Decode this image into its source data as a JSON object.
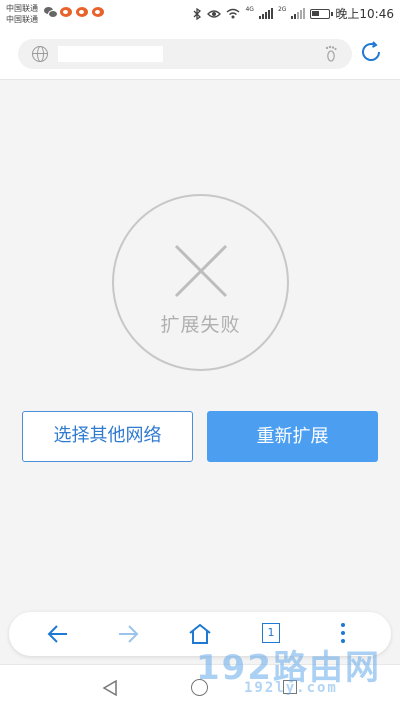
{
  "status_bar": {
    "carrier_1": "中国联通",
    "carrier_2": "中国联通",
    "network_label_1": "4G",
    "network_label_2": "2G",
    "time": "晚上10:46"
  },
  "address_bar": {
    "url_placeholder": "",
    "icons": [
      "globe-icon",
      "footprint-icon",
      "refresh-icon"
    ]
  },
  "status": {
    "fail_text": "扩展失败"
  },
  "buttons": {
    "other_network": "选择其他网络",
    "retry": "重新扩展"
  },
  "toolbar": {
    "tab_count": "1",
    "icons": [
      "back-arrow-icon",
      "forward-arrow-icon",
      "home-icon",
      "tabs-icon",
      "more-menu-icon"
    ]
  },
  "watermark": {
    "main": "192路由网",
    "sub": "192ly.com"
  },
  "colors": {
    "accent": "#4c9ff0",
    "accent_dark": "#1f78d1",
    "fail_gray": "#c7c7c7",
    "background": "#f4f4f4"
  }
}
